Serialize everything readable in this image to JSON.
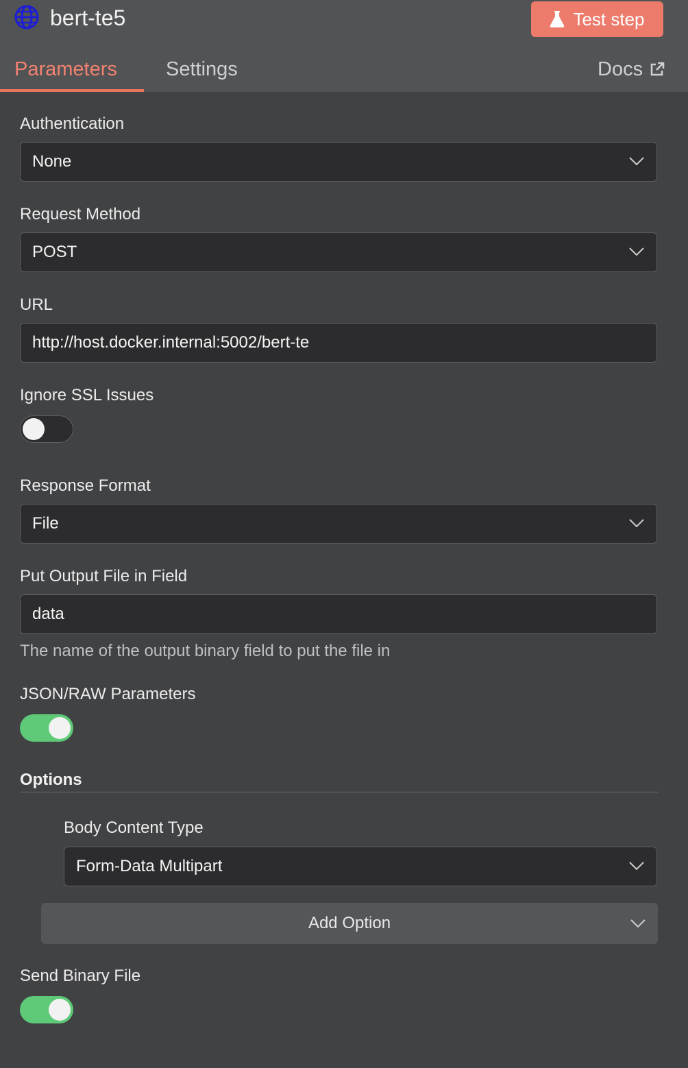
{
  "header": {
    "node_title": "bert-te5",
    "test_button_label": "Test step"
  },
  "tabs": {
    "parameters": "Parameters",
    "settings": "Settings",
    "docs": "Docs"
  },
  "fields": {
    "authentication": {
      "label": "Authentication",
      "value": "None"
    },
    "request_method": {
      "label": "Request Method",
      "value": "POST"
    },
    "url": {
      "label": "URL",
      "value": "http://host.docker.internal:5002/bert-te"
    },
    "ignore_ssl": {
      "label": "Ignore SSL Issues",
      "enabled": false
    },
    "response_format": {
      "label": "Response Format",
      "value": "File"
    },
    "output_field": {
      "label": "Put Output File in Field",
      "value": "data",
      "hint": "The name of the output binary field to put the file in"
    },
    "json_raw": {
      "label": "JSON/RAW Parameters",
      "enabled": true
    },
    "send_binary": {
      "label": "Send Binary File",
      "enabled": true
    }
  },
  "options": {
    "title": "Options",
    "body_content_type": {
      "label": "Body Content Type",
      "value": "Form-Data Multipart"
    },
    "add_option_label": "Add Option"
  },
  "colors": {
    "accent": "#ec7b6c",
    "toggle_on": "#5eca78",
    "icon_blue": "#1d1dd6"
  }
}
